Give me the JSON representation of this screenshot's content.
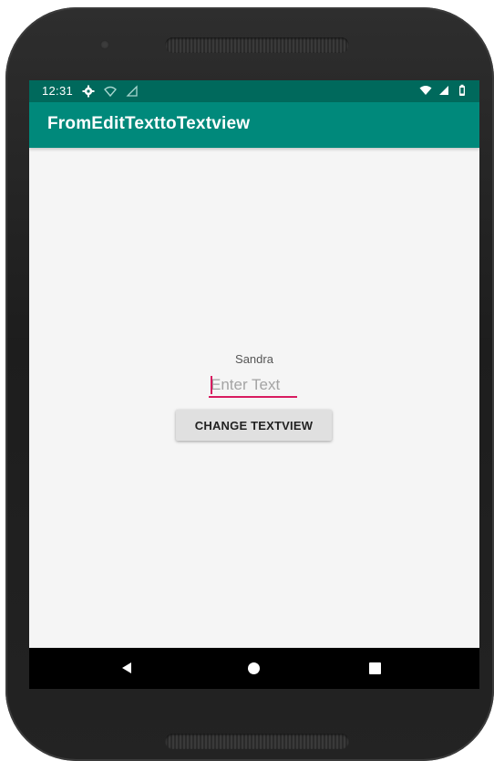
{
  "status_bar": {
    "time": "12:31",
    "left_icons": [
      "gear-icon",
      "wifi-icon",
      "signal-icon"
    ],
    "right_icons": [
      "wifi-icon",
      "signal-icon",
      "battery-icon"
    ]
  },
  "app_bar": {
    "title": "FromEditTexttoTextview"
  },
  "main": {
    "text_view": "Sandra",
    "edit_text": {
      "value": "",
      "placeholder": "Enter Text"
    },
    "change_button_label": "CHANGE TEXTVIEW"
  },
  "nav_bar": {
    "icons": [
      "back-icon",
      "home-icon",
      "recents-icon"
    ]
  },
  "colors": {
    "status_bar": "#00695c",
    "app_bar": "#00897b",
    "accent": "#d81b60",
    "background": "#f5f5f5"
  }
}
